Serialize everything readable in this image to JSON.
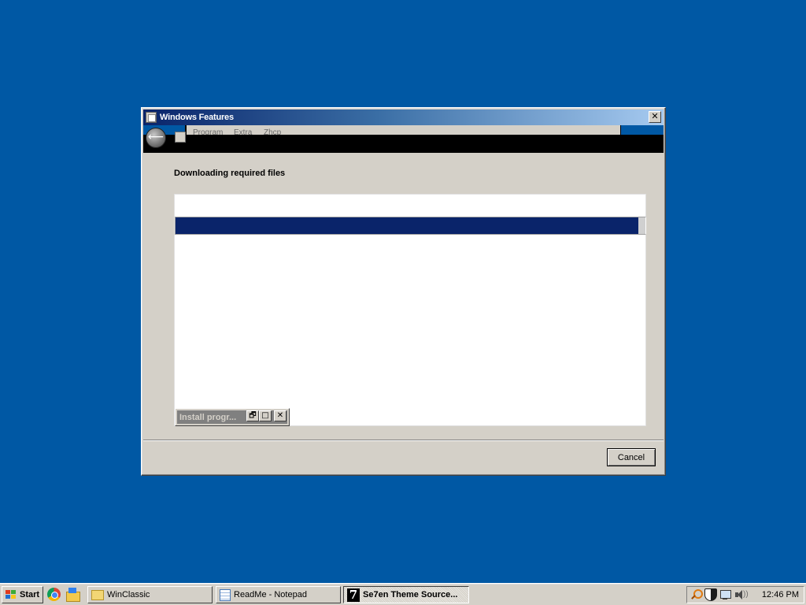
{
  "window": {
    "title": "Windows Features",
    "close_glyph": "✕",
    "menu": [
      "Program",
      "Extra",
      "Zhcp"
    ],
    "back_glyph": "⟵",
    "heading": "Downloading required files",
    "progress_fraction": 0.985,
    "mini_window": {
      "title": "Install progr...",
      "restore_glyph": "🗗",
      "maximize_glyph": "□",
      "close_glyph": "✕"
    },
    "cancel_label": "Cancel"
  },
  "taskbar": {
    "start_label": "Start",
    "quick_launch": [
      "chrome-icon",
      "home-icon"
    ],
    "tasks": [
      {
        "label": "WinClassic",
        "icon": "folder-icon",
        "active": false
      },
      {
        "label": "ReadMe - Notepad",
        "icon": "notepad-icon",
        "active": false
      },
      {
        "label": "Se7en Theme Source...",
        "icon": "seven-icon",
        "active": true
      }
    ],
    "tray_icons": [
      "search-tray-icon",
      "shield-tray-icon",
      "network-tray-icon",
      "speaker-tray-icon"
    ],
    "clock": "12:46 PM"
  },
  "colors": {
    "desktop": "#0058a4",
    "title_active_start": "#0a246a",
    "title_active_end": "#a6caf0",
    "progress_fill": "#0a246a",
    "face": "#d4d0c8"
  }
}
